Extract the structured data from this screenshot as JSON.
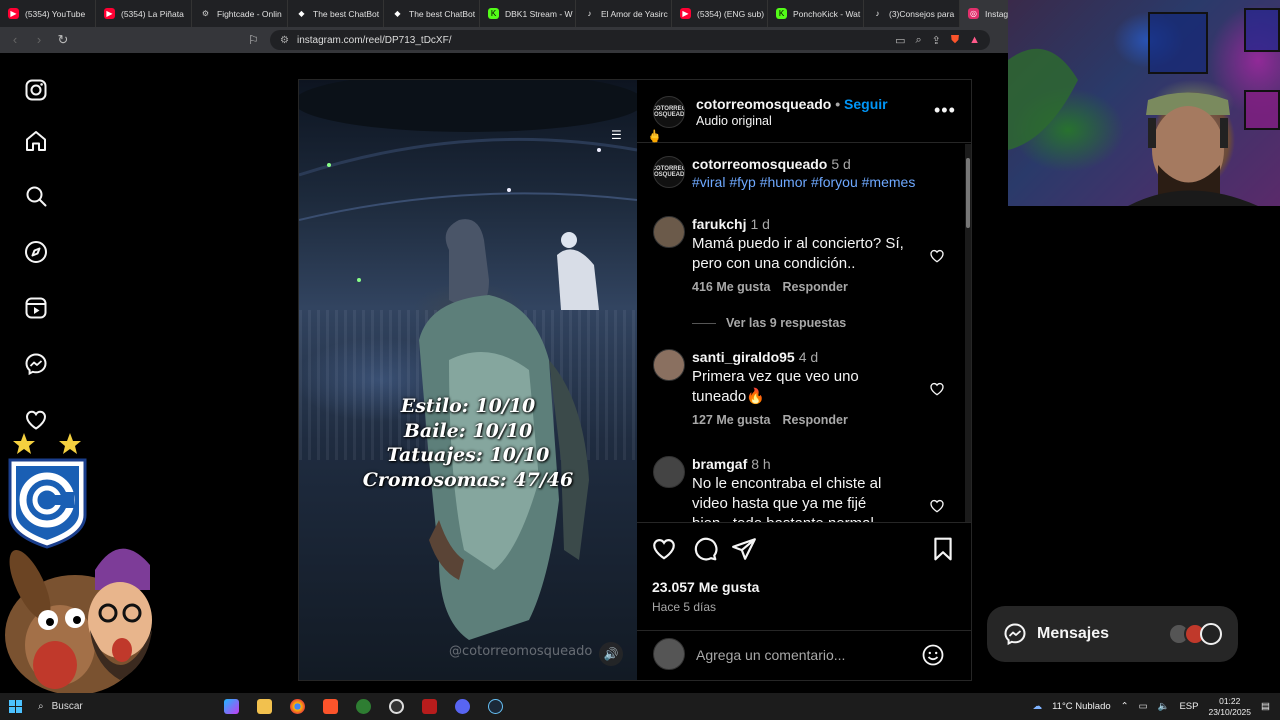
{
  "browser": {
    "tabs": [
      {
        "label": "(5354) YouTube",
        "icon": "youtube-icon",
        "color": "#ff0033"
      },
      {
        "label": "(5354) La Piñata",
        "icon": "youtube-icon",
        "color": "#ff0033"
      },
      {
        "label": "Fightcade - Onlin",
        "icon": "gear-icon",
        "color": "#888888"
      },
      {
        "label": "The best ChatBot",
        "icon": "chatbot-icon",
        "color": "#ffffff"
      },
      {
        "label": "The best ChatBot",
        "icon": "chatbot-icon",
        "color": "#ffffff"
      },
      {
        "label": "DBK1 Stream - W",
        "icon": "kick-icon",
        "color": "#53fc18"
      },
      {
        "label": "El Amor de Yasirc",
        "icon": "tiktok-icon",
        "color": "#ffffff"
      },
      {
        "label": "(5354) (ENG sub)",
        "icon": "youtube-icon",
        "color": "#ff0033"
      },
      {
        "label": "PonchoKick - Wat",
        "icon": "kick-icon",
        "color": "#53fc18"
      },
      {
        "label": "(3)Consejos para",
        "icon": "tiktok-icon",
        "color": "#ffffff"
      },
      {
        "label": "Instagram",
        "icon": "instagram-icon",
        "color": "#e1306c"
      }
    ],
    "url": "instagram.com/reel/DP713_tDcXF/"
  },
  "post": {
    "username": "cotorreomosqueado",
    "follow_separator": " • ",
    "follow_label": "Seguir",
    "audio": "Audio original",
    "avatar_text": "COTORREO MOSQUEADO",
    "video_overlay": [
      "Estilo: 10/10",
      "Baile: 10/10",
      "Tatuajes: 10/10",
      "Cromosomas: 47/46"
    ],
    "watermark": "@cotorreomosqueado",
    "likes": "23.057 Me gusta",
    "posted_ago": "Hace 5 días",
    "comment_placeholder": "Agrega un comentario..."
  },
  "caption": {
    "username": "cotorreomosqueado",
    "time": "5 d",
    "hashtags": "#viral #fyp #humor #foryou #memes"
  },
  "comments": [
    {
      "username": "farukchj",
      "time": "1 d",
      "text": "Mamá puedo ir al concierto? Sí, pero con una condición..",
      "likes": "416 Me gusta",
      "reply": "Responder",
      "view_replies": "Ver las 9 respuestas"
    },
    {
      "username": "santi_giraldo95",
      "time": "4 d",
      "text": "Primera vez que veo uno tuneado🔥",
      "likes": "127 Me gusta",
      "reply": "Responder"
    },
    {
      "username": "bramgaf",
      "time": "8 h",
      "text": "No le encontraba el chiste al video hasta que ya me fijé bien...todo bastante normal",
      "likes": "",
      "reply": ""
    }
  ],
  "messages": {
    "label": "Mensajes"
  },
  "taskbar": {
    "search": "Buscar",
    "weather": "11°C  Nublado",
    "lang": "ESP",
    "time": "01:22",
    "date": "23/10/2025"
  },
  "colors": {
    "accent": "#0095f6",
    "hashtag": "#6ea8fe",
    "muted": "#a8a8a8"
  }
}
